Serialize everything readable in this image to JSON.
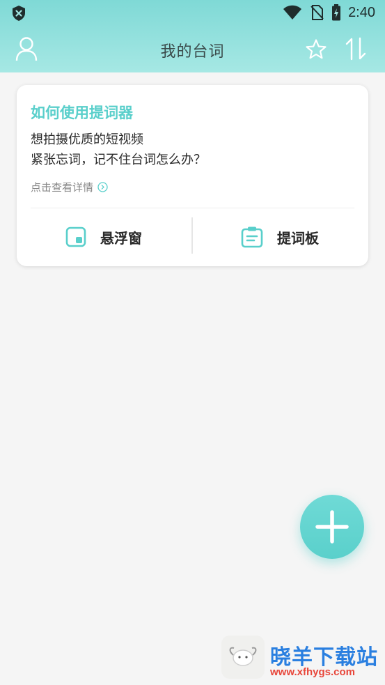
{
  "status_bar": {
    "time": "2:40"
  },
  "app_bar": {
    "title": "我的台词"
  },
  "intro_card": {
    "title": "如何使用提词器",
    "lines": [
      "想拍摄优质的短视频",
      "紧张忘词，记不住台词怎么办？"
    ],
    "detail_link": "点击查看详情",
    "actions": [
      {
        "label": "悬浮窗",
        "icon": "floating-window-icon"
      },
      {
        "label": "提词板",
        "icon": "clipboard-icon"
      }
    ]
  },
  "fab": {
    "icon": "plus-icon"
  },
  "watermark": {
    "name": "晓羊下载站",
    "url": "www.xfhygs.com"
  },
  "colors": {
    "accent": "#59cfcb",
    "header": "#8ee0dc",
    "background": "#f5f5f5"
  }
}
